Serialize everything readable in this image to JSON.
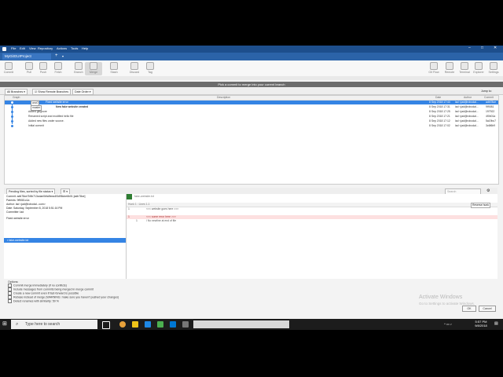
{
  "app": {
    "menu": [
      "File",
      "Edit",
      "View",
      "Repository",
      "Actions",
      "Tools",
      "Help"
    ],
    "repo_tab": "MyGitGUIProject"
  },
  "toolbar": {
    "items": [
      "Commit",
      "Pull",
      "Push",
      "Fetch",
      "Branch",
      "Merge",
      "Stash",
      "Discard",
      "Tag"
    ],
    "right_items": [
      "Git Flow",
      "Remote",
      "Terminal",
      "Explorer",
      "Settings"
    ]
  },
  "dialog": {
    "title": "Pick a commit to merge into your current branch",
    "filters": {
      "all_branches": "All Branches",
      "show_remote": "Show Remote Branches",
      "date_order": "Date Order",
      "jump": "Jump to:"
    },
    "columns": {
      "graph": "Graph",
      "description": "Description",
      "date": "Date",
      "author": "Author",
      "commit": "Commit"
    },
    "commits": [
      {
        "branch": "anc0",
        "desc": "Fixed website error",
        "date": "8 Sep 2018 17:44",
        "author": "lad <jad@robodal...",
        "hash": "adb78ce",
        "selected": true
      },
      {
        "branch": "master",
        "desc": "New fake website created",
        "date": "8 Sep 2018 17:31",
        "author": "lad <jad@robodal...",
        "hash": "9f9081",
        "selected": false
      },
      {
        "branch": "",
        "desc": "Added gitignore",
        "date": "8 Sep 2018 17:25",
        "author": "lad <jad@robodal...",
        "hash": "197922",
        "selected": false
      },
      {
        "branch": "",
        "desc": "Renamed script and modified hello file",
        "date": "8 Sep 2018 17:21",
        "author": "lad <jad@robodal...",
        "hash": "4f0b01a",
        "selected": false
      },
      {
        "branch": "",
        "desc": "Added new files under source.",
        "date": "8 Sep 2018 17:12",
        "author": "lad <jad@robodal...",
        "hash": "5a19bc7",
        "selected": false
      },
      {
        "branch": "",
        "desc": "Initial commit",
        "date": "8 Sep 2018 17:02",
        "author": "lad <jad@robodal...",
        "hash": "3c6f6b9",
        "selected": false
      }
    ],
    "lower": {
      "pending": "Pending files, sorted by file status",
      "commit_line": "Commit: adb78ce7b5b713cdae0bfa9eea4f3d98cbe6b01 [adb78ce]",
      "parents_line": "Parents: 9f9081c1a",
      "author_line": "Author: lad <jad@robodal...com>",
      "date_line": "Date: Saturday, September 8, 2018 5:51:16 PM",
      "committer_line": "Committer: lad",
      "message": "Fixed website error",
      "file": "fake-website.txt",
      "diff_file": "fake-website.txt",
      "hunk": "Hunk 1 : Lines 1-1",
      "reverse_hunk": "Reverse hunk",
      "diff_lines": [
        {
          "n": "1",
          "text": "<<< website goes here >>>",
          "type": "ctx"
        },
        {
          "n": "",
          "text": "",
          "type": "ctx"
        },
        {
          "n": "1",
          "text": "<<< some error here >>>",
          "type": "del"
        },
        {
          "n": "1",
          "text": "\\ No newline at end of file",
          "type": "ctx"
        }
      ],
      "search": "Search"
    },
    "options": {
      "heading": "Options:",
      "items": [
        "Commit merge immediately (if no conflicts)",
        "Include messages from commits being merged in merge commit",
        "Create a new commit even if fast-forward is possible",
        "Rebase instead of merge (WARNING: make sure you haven't pushed your changes)",
        "Detect renames with similarity: 50 %"
      ]
    },
    "ok": "OK",
    "cancel": "Cancel"
  },
  "windows": {
    "activate_title": "Activate Windows",
    "activate_sub": "Go to Settings to activate Windows.",
    "search_placeholder": "Type here to search",
    "time": "5:57 PM",
    "date": "9/8/2018"
  }
}
